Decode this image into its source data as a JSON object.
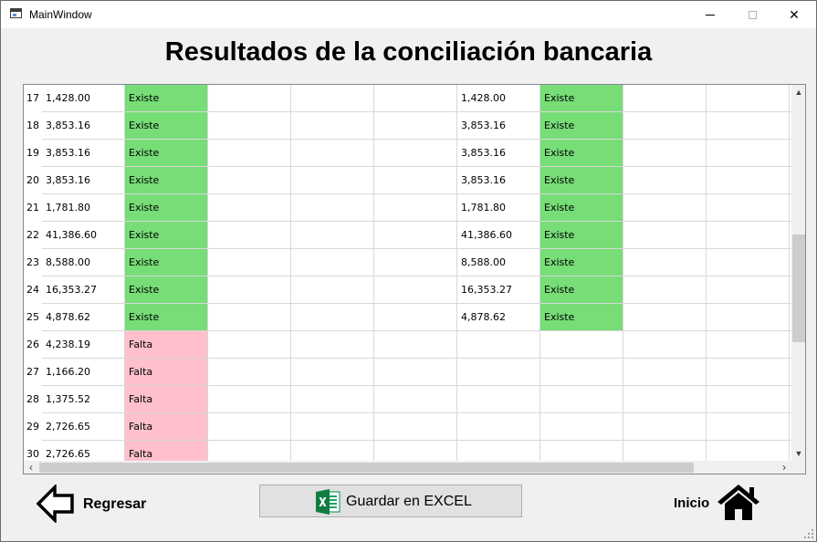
{
  "window": {
    "title": "MainWindow",
    "close_glyph": "✕"
  },
  "heading": "Resultados de la conciliación bancaria",
  "table": {
    "row_numbers": [
      "17",
      "18",
      "19",
      "20",
      "21",
      "22",
      "23",
      "24",
      "25",
      "26",
      "27",
      "28",
      "29",
      "30"
    ],
    "rows": [
      {
        "a_amount": "1,428.00",
        "a_status": "Existe",
        "b_amount": "1,428.00",
        "b_status": "Existe"
      },
      {
        "a_amount": "3,853.16",
        "a_status": "Existe",
        "b_amount": "3,853.16",
        "b_status": "Existe"
      },
      {
        "a_amount": "3,853.16",
        "a_status": "Existe",
        "b_amount": "3,853.16",
        "b_status": "Existe"
      },
      {
        "a_amount": "3,853.16",
        "a_status": "Existe",
        "b_amount": "3,853.16",
        "b_status": "Existe"
      },
      {
        "a_amount": "1,781.80",
        "a_status": "Existe",
        "b_amount": "1,781.80",
        "b_status": "Existe"
      },
      {
        "a_amount": "41,386.60",
        "a_status": "Existe",
        "b_amount": "41,386.60",
        "b_status": "Existe"
      },
      {
        "a_amount": "8,588.00",
        "a_status": "Existe",
        "b_amount": "8,588.00",
        "b_status": "Existe"
      },
      {
        "a_amount": "16,353.27",
        "a_status": "Existe",
        "b_amount": "16,353.27",
        "b_status": "Existe"
      },
      {
        "a_amount": "4,878.62",
        "a_status": "Existe",
        "b_amount": "4,878.62",
        "b_status": "Existe"
      },
      {
        "a_amount": "4,238.19",
        "a_status": "Falta",
        "b_amount": "",
        "b_status": ""
      },
      {
        "a_amount": "1,166.20",
        "a_status": "Falta",
        "b_amount": "",
        "b_status": ""
      },
      {
        "a_amount": "1,375.52",
        "a_status": "Falta",
        "b_amount": "",
        "b_status": ""
      },
      {
        "a_amount": "2,726.65",
        "a_status": "Falta",
        "b_amount": "",
        "b_status": ""
      },
      {
        "a_amount": "2,726.65",
        "a_status": "Falta",
        "b_amount": "",
        "b_status": ""
      }
    ],
    "status_colors": {
      "Existe": "#77dd77",
      "Falta": "#ffc0cb"
    },
    "scroll_arrows": {
      "up": "▲",
      "down": "▼",
      "left": "‹",
      "right": "›"
    }
  },
  "buttons": {
    "back_label": "Regresar",
    "back_icon": "arrow-left-icon",
    "excel_label": "Guardar en EXCEL",
    "excel_icon": "excel-icon",
    "home_label": "Inicio",
    "home_icon": "house-icon"
  }
}
